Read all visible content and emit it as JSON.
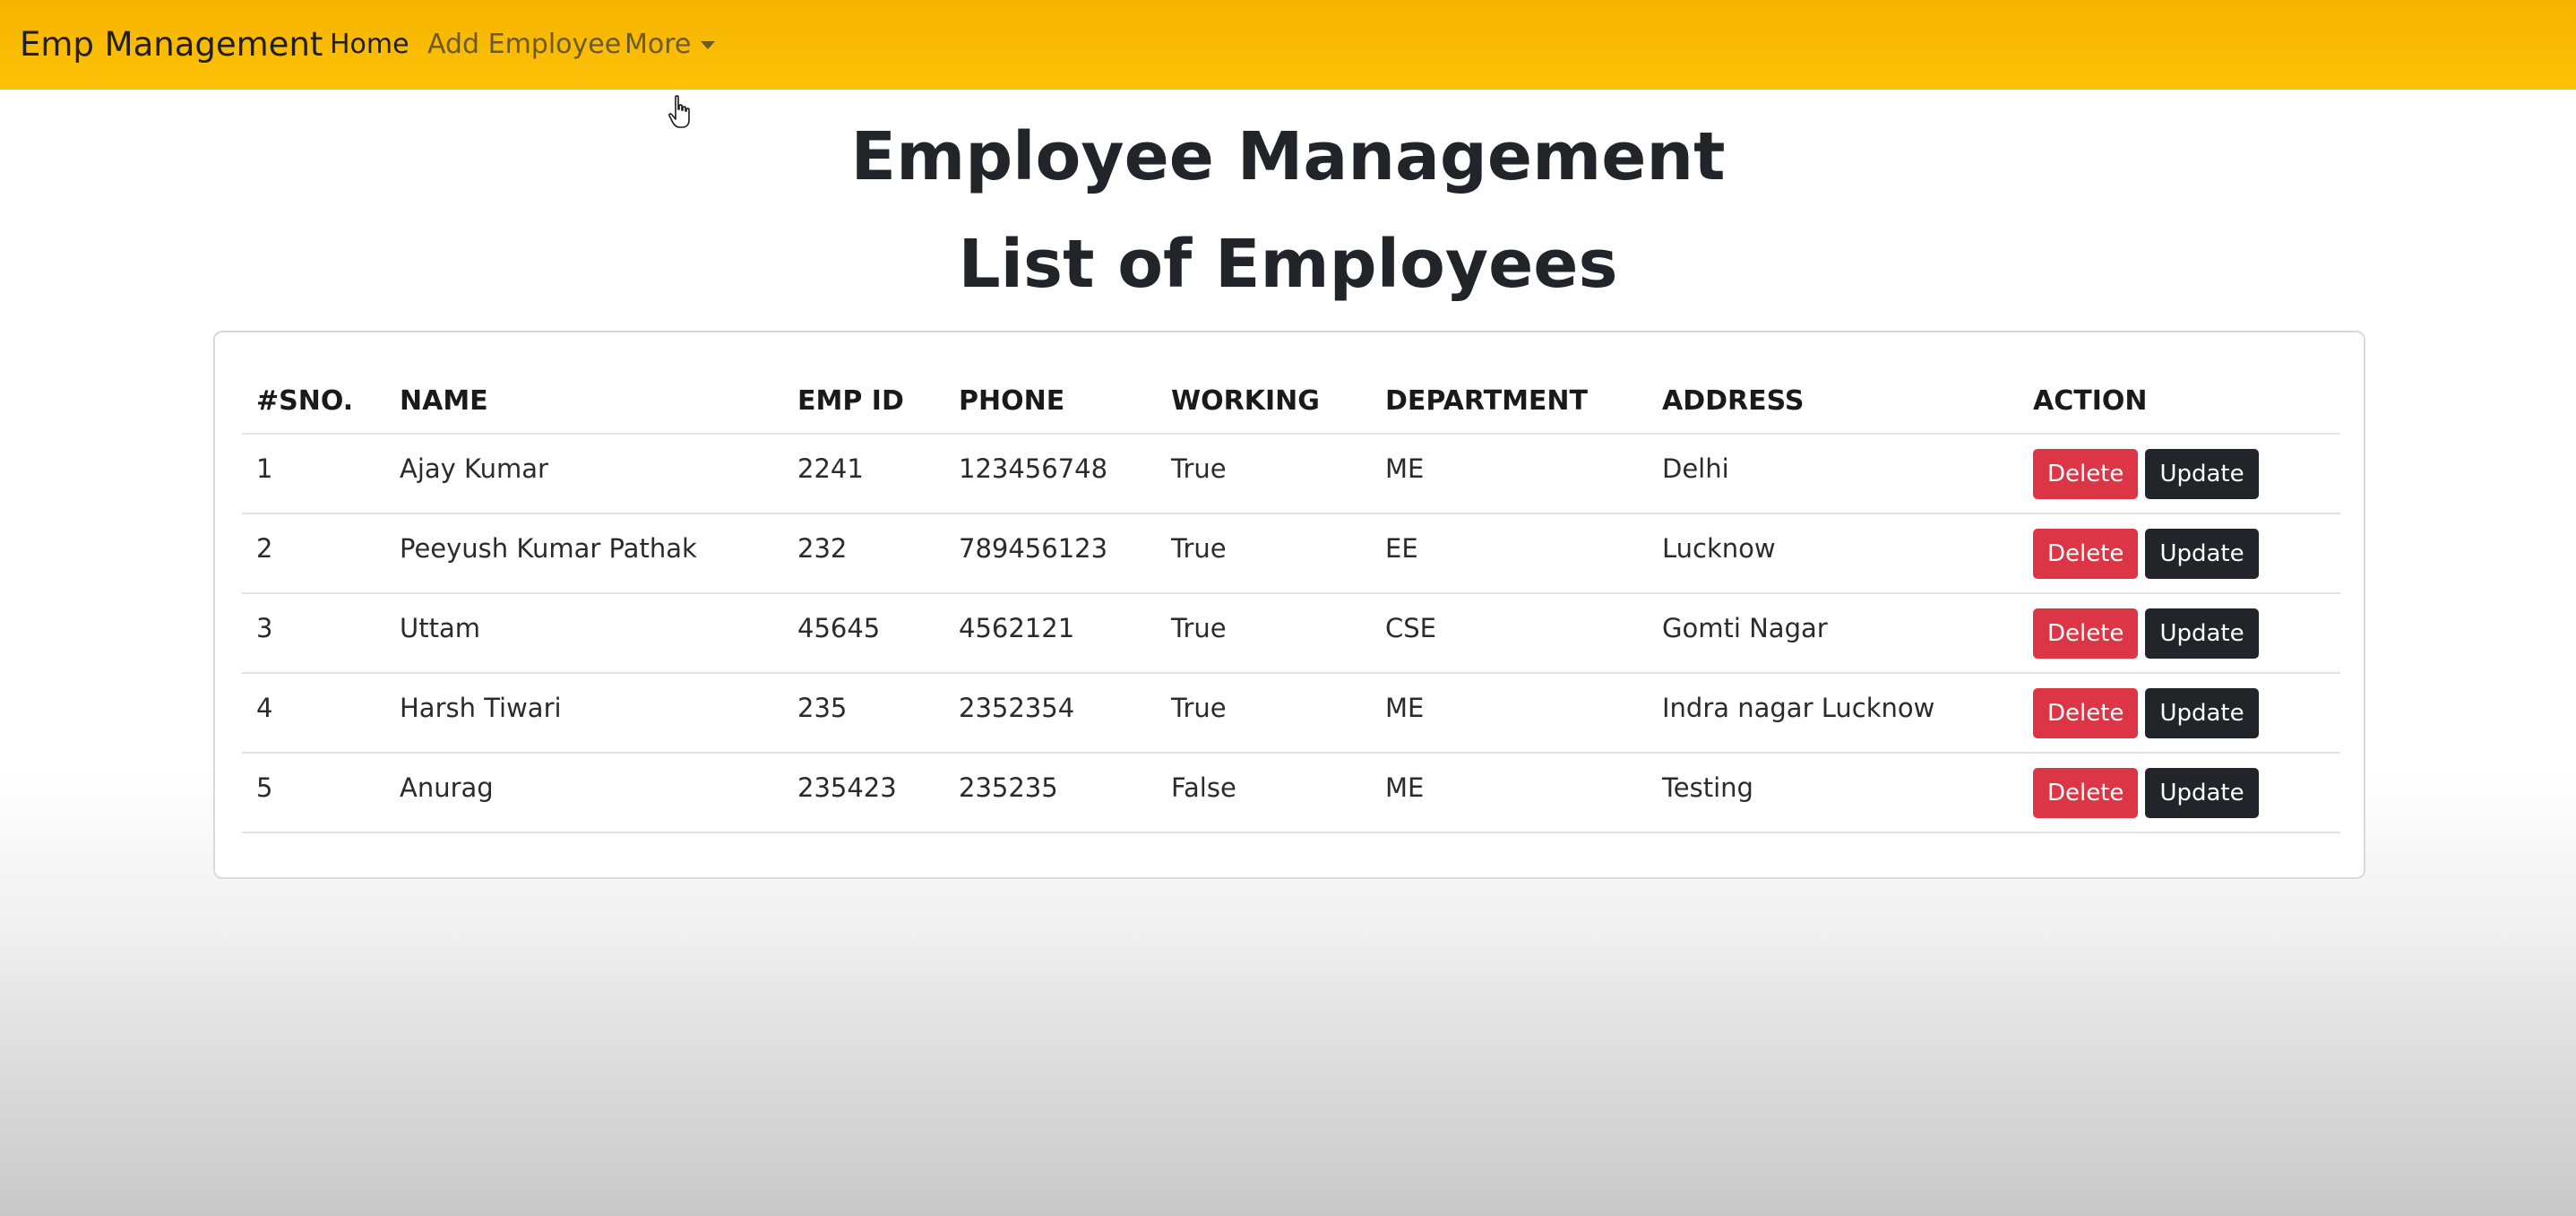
{
  "navbar": {
    "brand": "Emp Management",
    "links": [
      {
        "label": "Home"
      },
      {
        "label": "Add Employee"
      },
      {
        "label": "More"
      }
    ]
  },
  "page": {
    "title": "Employee Management",
    "subtitle": "List of Employees"
  },
  "table": {
    "headers": [
      "#SNO.",
      "NAME",
      "EMP ID",
      "PHONE",
      "WORKING",
      "DEPARTMENT",
      "ADDRESS",
      "ACTION"
    ],
    "rows": [
      {
        "sno": "1",
        "name": "Ajay Kumar",
        "emp_id": "2241",
        "phone": "123456748",
        "working": "True",
        "department": "ME",
        "address": "Delhi"
      },
      {
        "sno": "2",
        "name": "Peeyush Kumar Pathak",
        "emp_id": "232",
        "phone": "789456123",
        "working": "True",
        "department": "EE",
        "address": "Lucknow"
      },
      {
        "sno": "3",
        "name": "Uttam",
        "emp_id": "45645",
        "phone": "4562121",
        "working": "True",
        "department": "CSE",
        "address": "Gomti Nagar"
      },
      {
        "sno": "4",
        "name": "Harsh Tiwari",
        "emp_id": "235",
        "phone": "2352354",
        "working": "True",
        "department": "ME",
        "address": "Indra nagar Lucknow"
      },
      {
        "sno": "5",
        "name": "Anurag",
        "emp_id": "235423",
        "phone": "235235",
        "working": "False",
        "department": "ME",
        "address": "Testing"
      }
    ],
    "delete_label": "Delete",
    "update_label": "Update"
  },
  "colors": {
    "navbar": "#ffc107",
    "delete": "#dc3545",
    "update": "#212529"
  },
  "icons": {
    "cursor": "hand-pointer-icon",
    "dropdown": "caret-down-icon"
  }
}
